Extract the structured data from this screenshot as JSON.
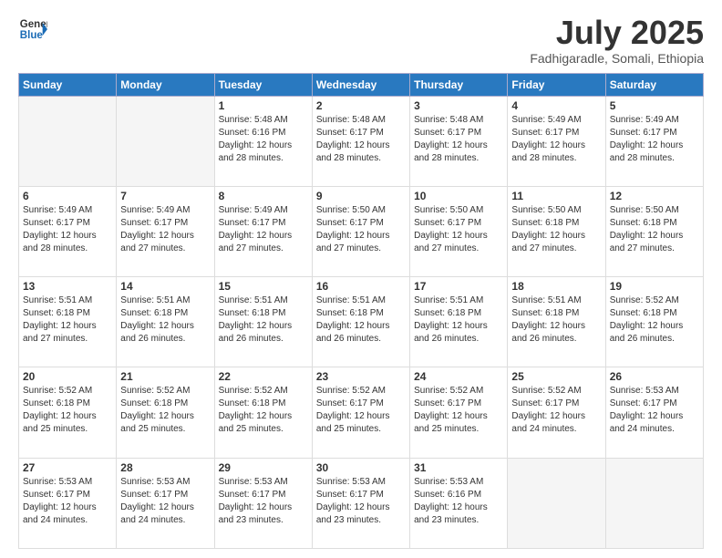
{
  "header": {
    "logo_line1": "General",
    "logo_line2": "Blue",
    "month": "July 2025",
    "location": "Fadhigaradle, Somali, Ethiopia"
  },
  "days_of_week": [
    "Sunday",
    "Monday",
    "Tuesday",
    "Wednesday",
    "Thursday",
    "Friday",
    "Saturday"
  ],
  "weeks": [
    [
      {
        "day": "",
        "info": ""
      },
      {
        "day": "",
        "info": ""
      },
      {
        "day": "1",
        "info": "Sunrise: 5:48 AM\nSunset: 6:16 PM\nDaylight: 12 hours and 28 minutes."
      },
      {
        "day": "2",
        "info": "Sunrise: 5:48 AM\nSunset: 6:17 PM\nDaylight: 12 hours and 28 minutes."
      },
      {
        "day": "3",
        "info": "Sunrise: 5:48 AM\nSunset: 6:17 PM\nDaylight: 12 hours and 28 minutes."
      },
      {
        "day": "4",
        "info": "Sunrise: 5:49 AM\nSunset: 6:17 PM\nDaylight: 12 hours and 28 minutes."
      },
      {
        "day": "5",
        "info": "Sunrise: 5:49 AM\nSunset: 6:17 PM\nDaylight: 12 hours and 28 minutes."
      }
    ],
    [
      {
        "day": "6",
        "info": "Sunrise: 5:49 AM\nSunset: 6:17 PM\nDaylight: 12 hours and 28 minutes."
      },
      {
        "day": "7",
        "info": "Sunrise: 5:49 AM\nSunset: 6:17 PM\nDaylight: 12 hours and 27 minutes."
      },
      {
        "day": "8",
        "info": "Sunrise: 5:49 AM\nSunset: 6:17 PM\nDaylight: 12 hours and 27 minutes."
      },
      {
        "day": "9",
        "info": "Sunrise: 5:50 AM\nSunset: 6:17 PM\nDaylight: 12 hours and 27 minutes."
      },
      {
        "day": "10",
        "info": "Sunrise: 5:50 AM\nSunset: 6:17 PM\nDaylight: 12 hours and 27 minutes."
      },
      {
        "day": "11",
        "info": "Sunrise: 5:50 AM\nSunset: 6:18 PM\nDaylight: 12 hours and 27 minutes."
      },
      {
        "day": "12",
        "info": "Sunrise: 5:50 AM\nSunset: 6:18 PM\nDaylight: 12 hours and 27 minutes."
      }
    ],
    [
      {
        "day": "13",
        "info": "Sunrise: 5:51 AM\nSunset: 6:18 PM\nDaylight: 12 hours and 27 minutes."
      },
      {
        "day": "14",
        "info": "Sunrise: 5:51 AM\nSunset: 6:18 PM\nDaylight: 12 hours and 26 minutes."
      },
      {
        "day": "15",
        "info": "Sunrise: 5:51 AM\nSunset: 6:18 PM\nDaylight: 12 hours and 26 minutes."
      },
      {
        "day": "16",
        "info": "Sunrise: 5:51 AM\nSunset: 6:18 PM\nDaylight: 12 hours and 26 minutes."
      },
      {
        "day": "17",
        "info": "Sunrise: 5:51 AM\nSunset: 6:18 PM\nDaylight: 12 hours and 26 minutes."
      },
      {
        "day": "18",
        "info": "Sunrise: 5:51 AM\nSunset: 6:18 PM\nDaylight: 12 hours and 26 minutes."
      },
      {
        "day": "19",
        "info": "Sunrise: 5:52 AM\nSunset: 6:18 PM\nDaylight: 12 hours and 26 minutes."
      }
    ],
    [
      {
        "day": "20",
        "info": "Sunrise: 5:52 AM\nSunset: 6:18 PM\nDaylight: 12 hours and 25 minutes."
      },
      {
        "day": "21",
        "info": "Sunrise: 5:52 AM\nSunset: 6:18 PM\nDaylight: 12 hours and 25 minutes."
      },
      {
        "day": "22",
        "info": "Sunrise: 5:52 AM\nSunset: 6:18 PM\nDaylight: 12 hours and 25 minutes."
      },
      {
        "day": "23",
        "info": "Sunrise: 5:52 AM\nSunset: 6:17 PM\nDaylight: 12 hours and 25 minutes."
      },
      {
        "day": "24",
        "info": "Sunrise: 5:52 AM\nSunset: 6:17 PM\nDaylight: 12 hours and 25 minutes."
      },
      {
        "day": "25",
        "info": "Sunrise: 5:52 AM\nSunset: 6:17 PM\nDaylight: 12 hours and 24 minutes."
      },
      {
        "day": "26",
        "info": "Sunrise: 5:53 AM\nSunset: 6:17 PM\nDaylight: 12 hours and 24 minutes."
      }
    ],
    [
      {
        "day": "27",
        "info": "Sunrise: 5:53 AM\nSunset: 6:17 PM\nDaylight: 12 hours and 24 minutes."
      },
      {
        "day": "28",
        "info": "Sunrise: 5:53 AM\nSunset: 6:17 PM\nDaylight: 12 hours and 24 minutes."
      },
      {
        "day": "29",
        "info": "Sunrise: 5:53 AM\nSunset: 6:17 PM\nDaylight: 12 hours and 23 minutes."
      },
      {
        "day": "30",
        "info": "Sunrise: 5:53 AM\nSunset: 6:17 PM\nDaylight: 12 hours and 23 minutes."
      },
      {
        "day": "31",
        "info": "Sunrise: 5:53 AM\nSunset: 6:16 PM\nDaylight: 12 hours and 23 minutes."
      },
      {
        "day": "",
        "info": ""
      },
      {
        "day": "",
        "info": ""
      }
    ]
  ]
}
